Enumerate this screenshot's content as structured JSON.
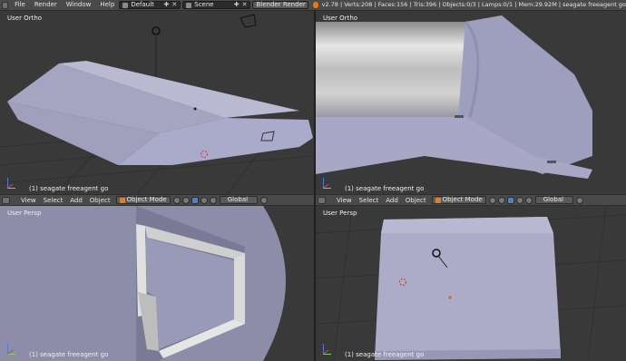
{
  "topbar": {
    "menus": [
      "File",
      "Render",
      "Window",
      "Help"
    ],
    "layout_field": "Default",
    "scene_field": "Scene",
    "engine": "Blender Render",
    "stats": "v2.78 | Verts:208 | Faces:156 | Tris:396 | Objects:0/3 | Lamps:0/1 | Mem:29.92M | seagate freeagent go"
  },
  "viewports": {
    "top_left": {
      "title": "User Ortho",
      "object": "(1) seagate freeagent go"
    },
    "top_right": {
      "title": "User Ortho",
      "object": "(1) seagate freeagent go"
    },
    "bottom_left": {
      "title": "User Persp",
      "object": "(1) seagate freeagent go"
    },
    "bottom_right": {
      "title": "User Persp",
      "object": "(1) seagate freeagent go"
    }
  },
  "header": {
    "menus": [
      "View",
      "Select",
      "Add",
      "Object"
    ],
    "mode": "Object Mode",
    "orientation": "Global"
  },
  "colors": {
    "viewport_bg": "#393939",
    "object_color": "#a9a9c8",
    "accent": "#5680c2"
  }
}
